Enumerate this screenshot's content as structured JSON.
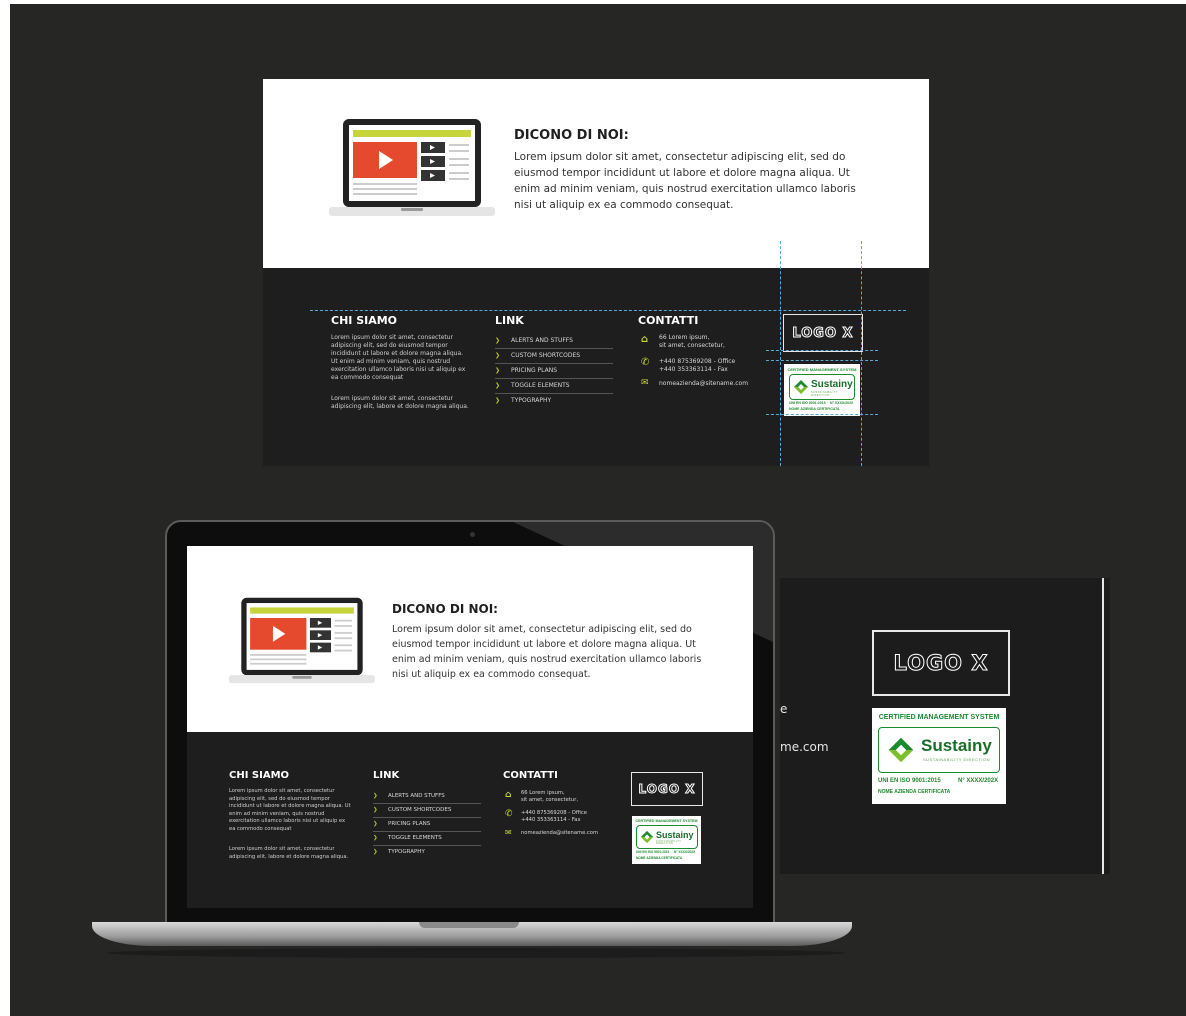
{
  "colors": {
    "background": "#262625",
    "footer": "#1e1e1e",
    "accent": "#b8cc1e",
    "play_red": "#e64a2e",
    "cert_green": "#1c8a2e",
    "guides": "#58a9d3"
  },
  "icons": {
    "laptop": "laptop-video-illustration",
    "home": "home-icon",
    "phone": "phone-icon",
    "mail": "mail-icon",
    "chevron": "chevron-right-icon",
    "certification": "sustainy-arrows-icon"
  },
  "testimonial": {
    "title": "DICONO DI NOI:",
    "body": "Lorem ipsum dolor sit amet, consectetur adipiscing elit, sed do eiusmod tempor incididunt ut labore et dolore magna aliqua. Ut enim ad minim veniam, quis nostrud exercitation ullamco laboris nisi ut aliquip ex ea commodo consequat."
  },
  "footer": {
    "chi_siamo": {
      "title": "CHI SIAMO",
      "p1": "Lorem ipsum dolor sit amet, consectetur adipiscing elit, sed do eiusmod tempor incididunt ut labore et dolore magna aliqua. Ut enim ad minim veniam, quis nostrud exercitation ullamco laboris nisi ut aliquip ex ea commodo consequat",
      "p2": "Lorem ipsum dolor sit amet, consectetur adipiscing elit, labore et dolore magna aliqua."
    },
    "link": {
      "title": "LINK",
      "items": [
        "ALERTS AND STUFFS",
        "CUSTOM SHORTCODES",
        "PRICING PLANS",
        "TOGGLE ELEMENTS",
        "TYPOGRAPHY"
      ]
    },
    "contatti": {
      "title": "CONTATTI",
      "address_1": "66 Lorem ipsum,",
      "address_2": "sit amet, consectetur,",
      "phone_1": "+440 875369208 - Office",
      "phone_2": "+440 353363114 - Fax",
      "email": "nomeazienda@sitename.com"
    },
    "logo": "LOGO X",
    "certificate": {
      "header": "CERTIFIED MANAGEMENT SYSTEM",
      "brand": "Sustainy",
      "brand_sub": "SUSTAINABILITY DIRECTION",
      "standard": "UNI EN ISO 9001:2015",
      "number": "N° XXXX/202X",
      "company": "NOME AZIENDA CERTIFICATA"
    }
  },
  "zoom_fragments": {
    "frag_1": "e",
    "frag_2": "me.com"
  }
}
